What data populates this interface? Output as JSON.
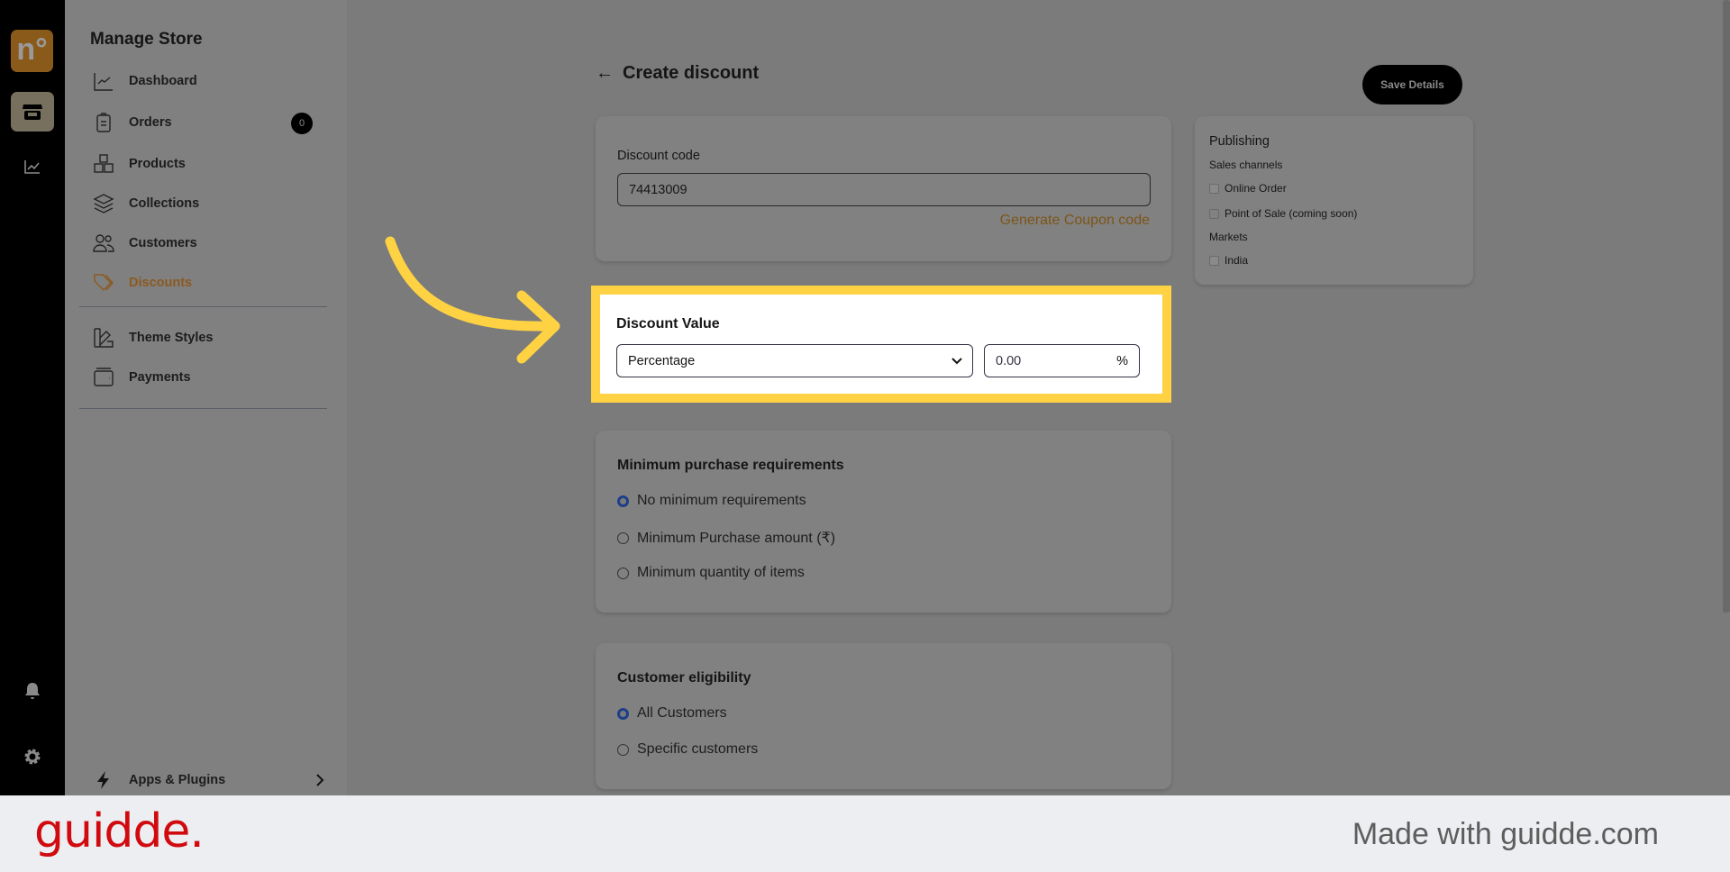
{
  "rail": {
    "logo": "n°",
    "icons": [
      "store-icon",
      "chart-icon",
      "bell-icon",
      "gear-icon"
    ]
  },
  "sidebar": {
    "title": "Manage Store",
    "items": [
      {
        "label": "Dashboard",
        "icon": "chart-line-icon"
      },
      {
        "label": "Orders",
        "icon": "clipboard-icon",
        "badge": "0"
      },
      {
        "label": "Products",
        "icon": "boxes-icon"
      },
      {
        "label": "Collections",
        "icon": "layers-icon"
      },
      {
        "label": "Customers",
        "icon": "users-icon"
      },
      {
        "label": "Discounts",
        "icon": "tag-icon",
        "active": true
      },
      {
        "label": "Theme Styles",
        "icon": "palette-icon"
      },
      {
        "label": "Payments",
        "icon": "wallet-icon"
      }
    ],
    "apps": "Apps & Plugins"
  },
  "header": {
    "title": "Create discount",
    "save": "Save Details"
  },
  "code": {
    "label": "Discount code",
    "value": "74413009",
    "generate": "Generate Coupon code"
  },
  "value": {
    "label": "Discount Value",
    "type": "Percentage",
    "amount": "0.00",
    "suffix": "%"
  },
  "minimum": {
    "label": "Minimum purchase requirements",
    "options": [
      "No minimum requirements",
      "Minimum Purchase amount (₹)",
      "Minimum quantity of items"
    ],
    "selected": 0
  },
  "eligibility": {
    "label": "Customer eligibility",
    "options": [
      "All Customers",
      "Specific customers"
    ],
    "selected": 0
  },
  "publishing": {
    "title": "Publishing",
    "channels_label": "Sales channels",
    "channels": [
      {
        "label": "Online Order",
        "checked": true
      },
      {
        "label": "Point of Sale (coming soon)",
        "checked": false
      }
    ],
    "markets_label": "Markets",
    "markets": [
      {
        "label": "India",
        "checked": true
      }
    ]
  },
  "footer": {
    "logo": "guidde.",
    "made": "Made with guidde.com"
  },
  "colors": {
    "highlight": "#fed242",
    "accent": "#8a5a20",
    "brand": "#d10a10"
  }
}
